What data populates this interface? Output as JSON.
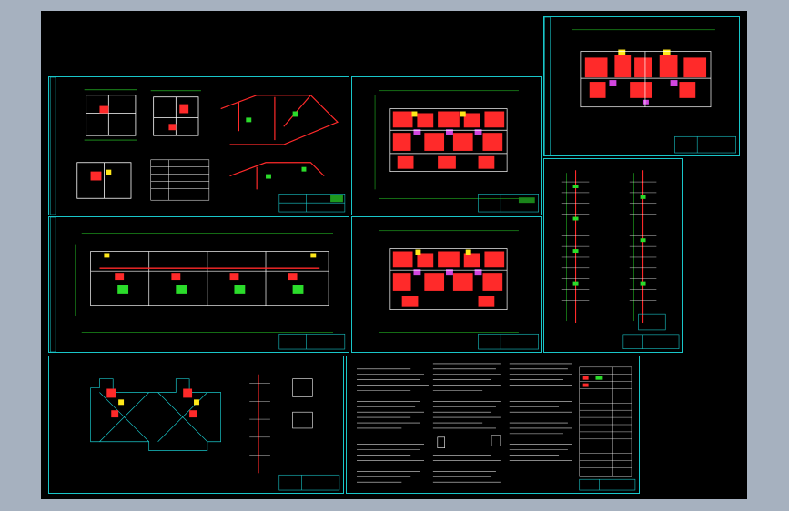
{
  "viewer": {
    "background_color": "#a6b1bf",
    "canvas_color": "#000000",
    "frame_color": "#19c6c9",
    "drawing_colors": {
      "wall": "#ffffff",
      "pipe_red": "#ff2a2a",
      "grid_green": "#2bdc2b",
      "accent_yellow": "#ffe81a",
      "accent_magenta": "#d246e0",
      "accent_cyan": "#19c6c9"
    }
  },
  "sheets": [
    {
      "id": "sheet-details-top-left",
      "content": "detail-plans-and-axonometric",
      "title_text": ""
    },
    {
      "id": "sheet-floor-plan-a",
      "content": "floor-plan-colored",
      "title_text": ""
    },
    {
      "id": "sheet-floor-plan-b",
      "content": "floor-plan-colored",
      "title_text": ""
    },
    {
      "id": "sheet-long-plan",
      "content": "long-building-plan",
      "title_text": ""
    },
    {
      "id": "sheet-plan-top-right",
      "content": "floor-plan-colored",
      "title_text": ""
    },
    {
      "id": "sheet-risers",
      "content": "riser-diagrams",
      "title_text": ""
    },
    {
      "id": "sheet-roof-plan",
      "content": "roof-plan-and-details",
      "title_text": ""
    },
    {
      "id": "sheet-notes",
      "content": "design-notes-and-table",
      "title_text": ""
    }
  ]
}
